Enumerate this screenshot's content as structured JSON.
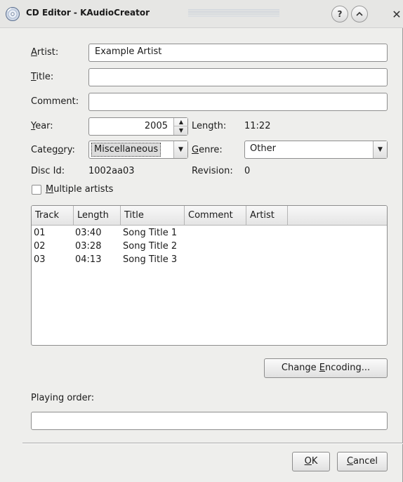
{
  "window": {
    "title": "CD Editor - KAudioCreator",
    "help_symbol": "?",
    "minimize_symbol": "^",
    "close_symbol": "✕"
  },
  "form": {
    "artist": {
      "label_hot": "A",
      "label_rest": "rtist:",
      "value": "Example Artist"
    },
    "title": {
      "label_hot": "T",
      "label_rest": "itle:",
      "value": ""
    },
    "comment": {
      "label": "Comment:",
      "value": ""
    },
    "year": {
      "label_hot": "Y",
      "label_rest": "ear:",
      "value": "2005"
    },
    "length": {
      "label": "Length:",
      "value": "11:22"
    },
    "category": {
      "label_pre": "Categ",
      "label_hot": "o",
      "label_post": "ry:",
      "value": "Miscellaneous"
    },
    "genre": {
      "label_hot": "G",
      "label_rest": "enre:",
      "value": "Other"
    },
    "disc_id": {
      "label": "Disc Id:",
      "value": "1002aa03"
    },
    "revision": {
      "label": "Revision:",
      "value": "0"
    },
    "multiple_artists": {
      "label_hot": "M",
      "label_rest": "ultiple artists",
      "checked": false
    }
  },
  "tracks": {
    "columns": [
      "Track",
      "Length",
      "Title",
      "Comment",
      "Artist"
    ],
    "rows": [
      {
        "track": "01",
        "length": "03:40",
        "title": "Song Title 1",
        "comment": "",
        "artist": ""
      },
      {
        "track": "02",
        "length": "03:28",
        "title": "Song Title 2",
        "comment": "",
        "artist": ""
      },
      {
        "track": "03",
        "length": "04:13",
        "title": "Song Title 3",
        "comment": "",
        "artist": ""
      }
    ]
  },
  "buttons": {
    "change_encoding": {
      "pre": "Change ",
      "hot": "E",
      "post": "ncoding..."
    },
    "ok": {
      "hot": "O",
      "post": "K"
    },
    "cancel": {
      "hot": "C",
      "post": "ancel"
    }
  },
  "playing_order": {
    "label": "Playing order:",
    "value": ""
  }
}
